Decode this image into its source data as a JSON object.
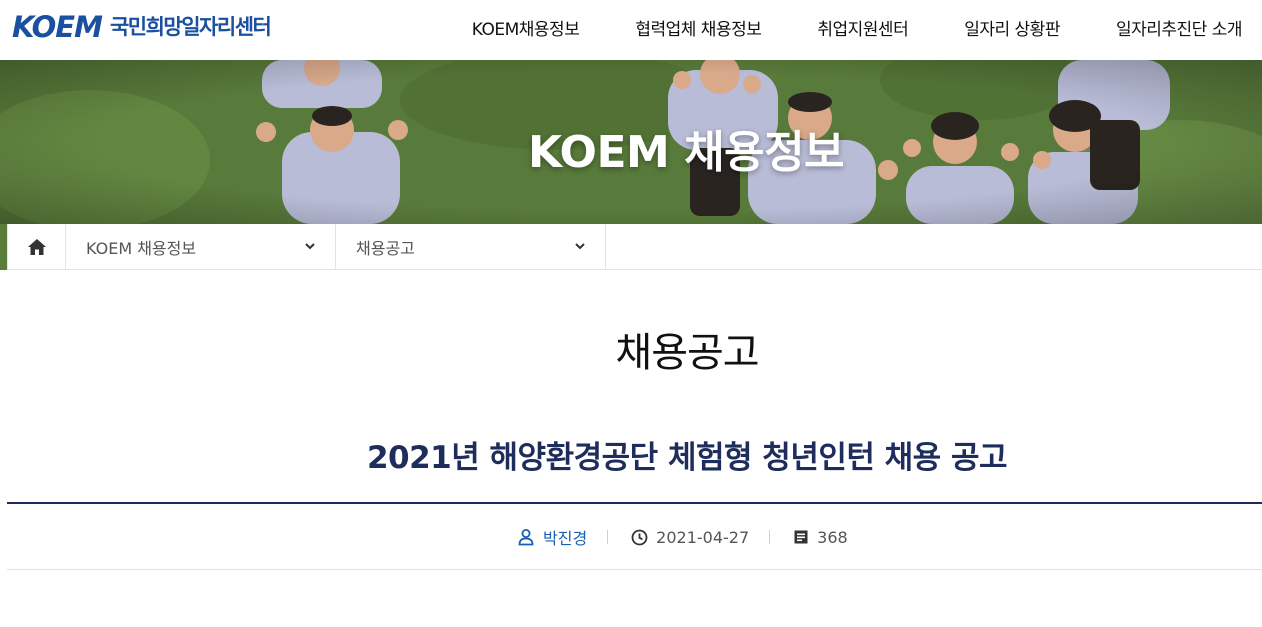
{
  "header": {
    "logo_mark": "KOEM",
    "logo_text": "국민희망일자리센터",
    "nav": [
      {
        "label": "KOEM채용정보"
      },
      {
        "label": "협력업체 채용정보"
      },
      {
        "label": "취업지원센터"
      },
      {
        "label": "일자리 상황판"
      },
      {
        "label": "일자리추진단 소개"
      }
    ]
  },
  "banner": {
    "title": "KOEM 채용정보"
  },
  "breadcrumb": {
    "home_icon": "home-icon",
    "level1": "KOEM 채용정보",
    "level2": "채용공고",
    "dropdown_icon": "chevron-down-icon"
  },
  "content": {
    "page_title": "채용공고",
    "post_title": "2021년 해양환경공단 체험형 청년인턴 채용 공고",
    "meta": {
      "author": "박진경",
      "date": "2021-04-27",
      "views": "368"
    }
  },
  "colors": {
    "brand": "#1b4fa0",
    "title_navy": "#1e2d5c",
    "author_blue": "#1a5fb4"
  }
}
